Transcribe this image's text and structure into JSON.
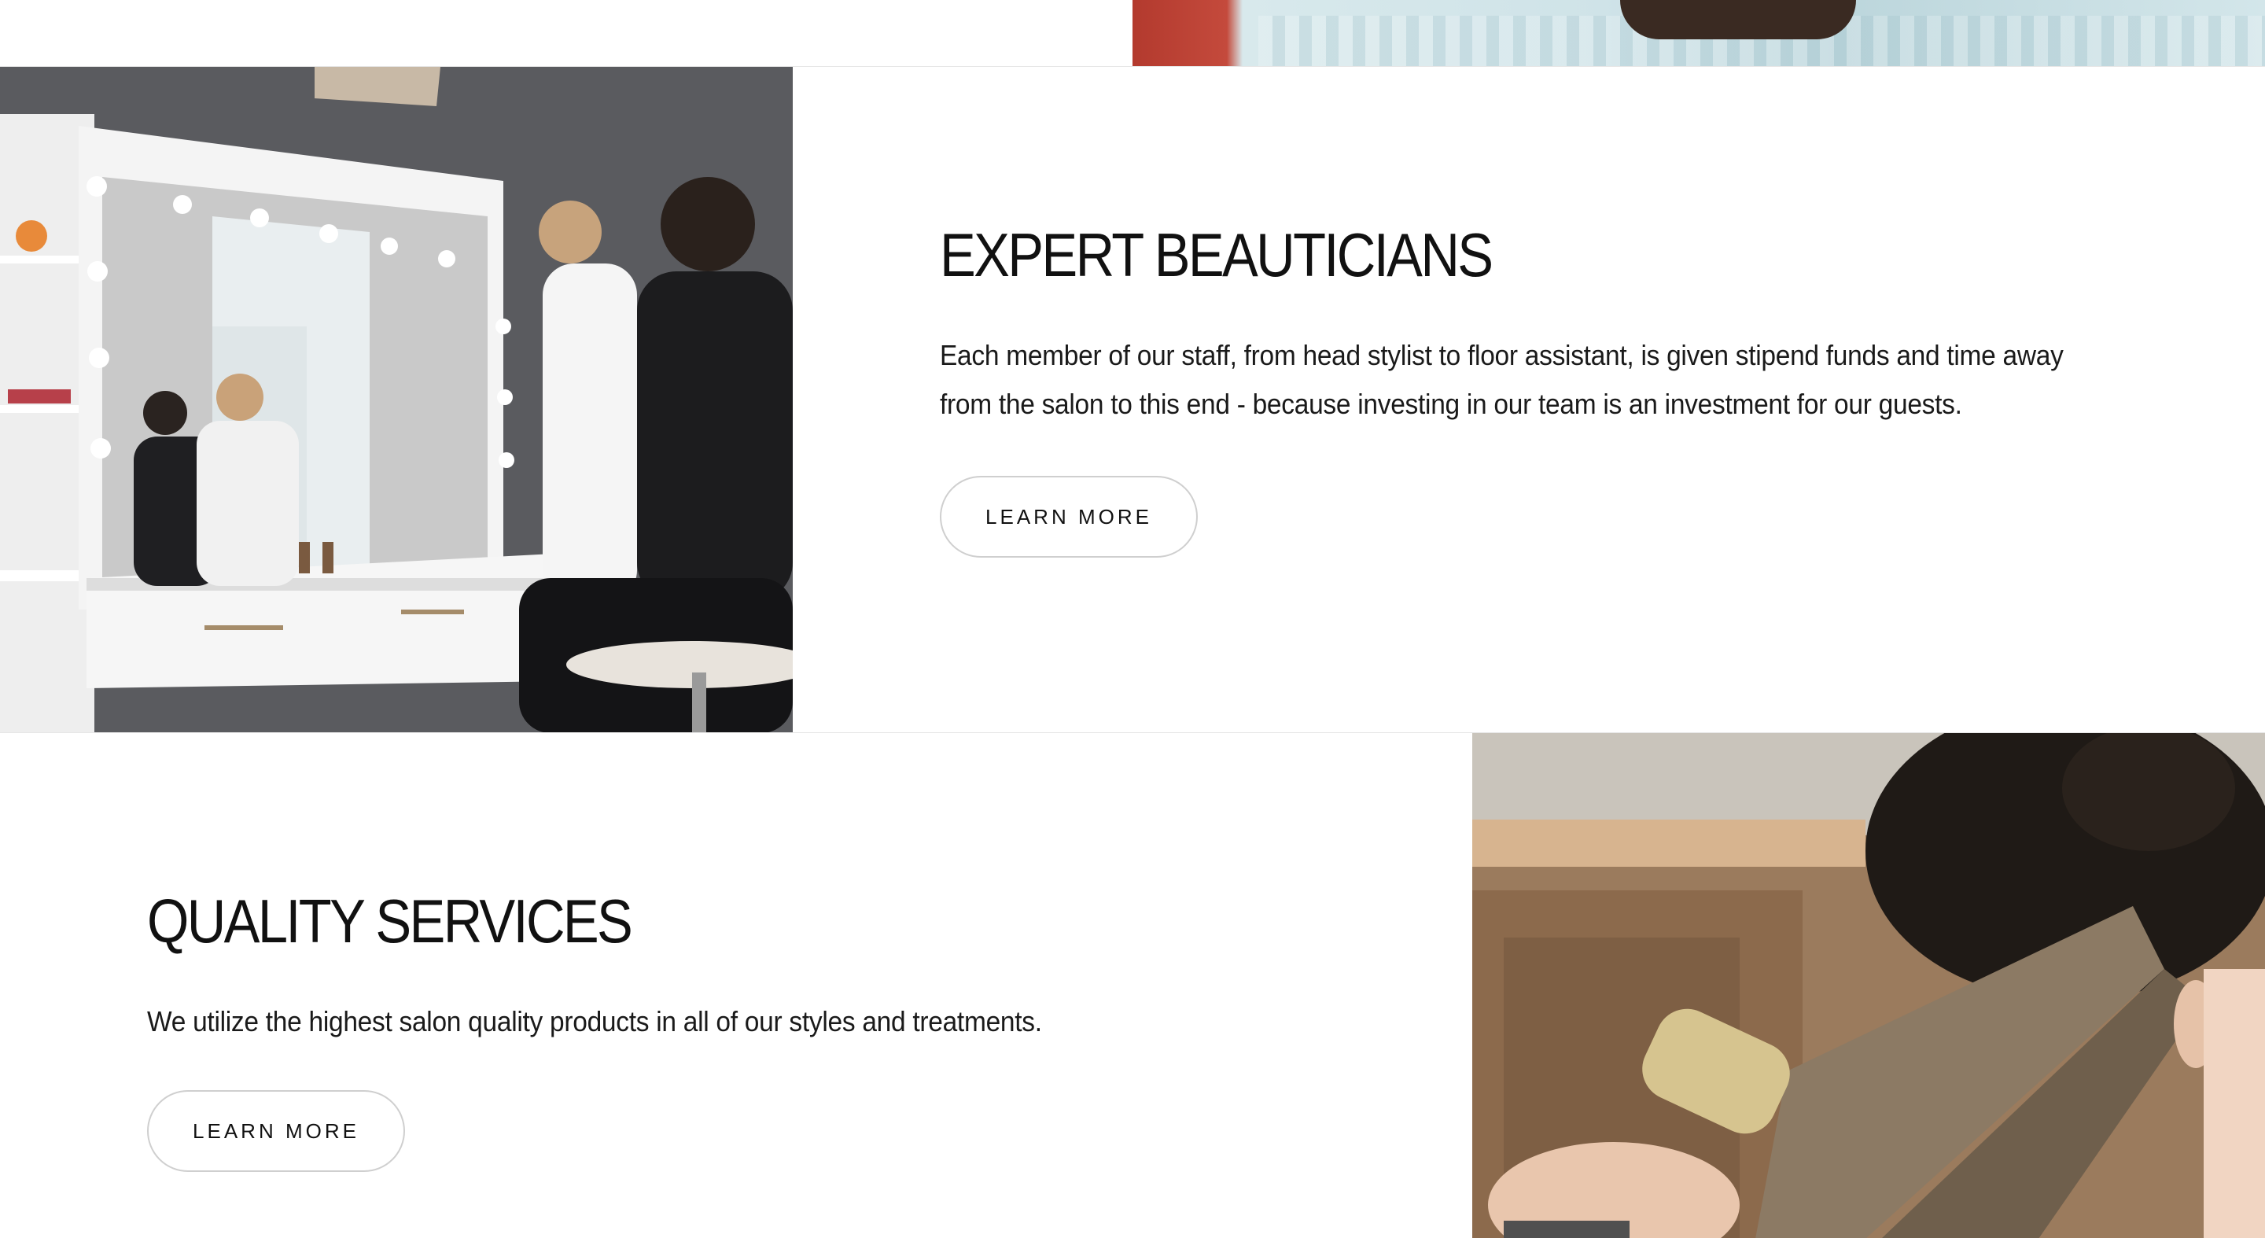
{
  "sections": [
    {
      "title": "EXPERT BEAUTICIANS",
      "body": "Each member of our staff, from head stylist to floor assistant, is given stipend funds and time away from the salon to this end - because investing in our team is an investment for our guests.",
      "button_label": "LEARN MORE"
    },
    {
      "title": "QUALITY SERVICES",
      "body": "We utilize the highest salon quality products in all of our styles and treatments.",
      "button_label": "LEARN MORE"
    }
  ]
}
